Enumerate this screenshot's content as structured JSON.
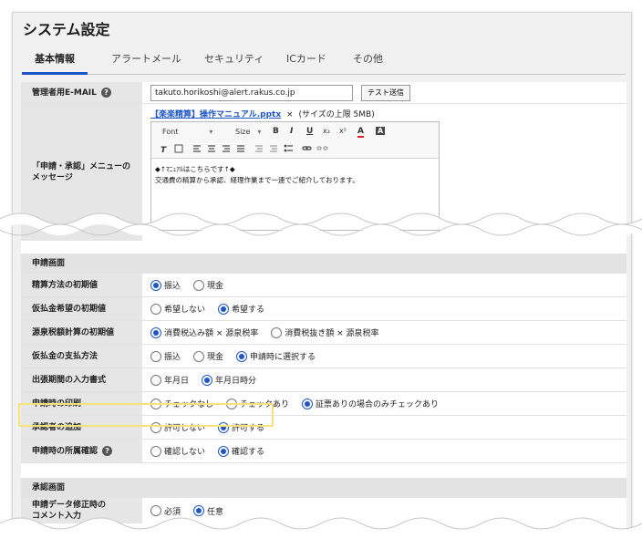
{
  "page_title": "システム設定",
  "tabs": [
    {
      "label": "基本情報",
      "active": true
    },
    {
      "label": "アラートメール",
      "active": false
    },
    {
      "label": "セキュリティ",
      "active": false
    },
    {
      "label": "ICカード",
      "active": false
    },
    {
      "label": "その他",
      "active": false
    }
  ],
  "email": {
    "label": "管理者用E-MAIL",
    "value": "takuto.horikoshi@alert.rakus.co.jp",
    "test_button": "テスト送信"
  },
  "message": {
    "label_line1": "「申請・承認」メニューの",
    "label_line2": "メッセージ",
    "attachment_link": "【楽楽精算】操作マニュアル.pptx",
    "attachment_remove": "×",
    "attachment_note": "(サイズの上限 5MB)",
    "toolbar": {
      "font": "Font",
      "size": "Size",
      "bold": "B",
      "italic": "I",
      "underline": "U",
      "subscript": "x₂",
      "superscript": "x²",
      "text_color": "A",
      "bg_color": "A"
    },
    "editor_line1": "◆↑ﾏﾆｭｱﾙはこちらです↑◆",
    "editor_line2": "交通費の精算から承認、経理作業まで一連でご紹介しております。"
  },
  "section_apply": {
    "title": "申請画面",
    "rows": [
      {
        "label": "精算方法の初期値",
        "options": [
          {
            "label": "振込",
            "checked": true
          },
          {
            "label": "現金",
            "checked": false
          }
        ]
      },
      {
        "label": "仮払金希望の初期値",
        "options": [
          {
            "label": "希望しない",
            "checked": false
          },
          {
            "label": "希望する",
            "checked": true
          }
        ]
      },
      {
        "label": "源泉税額計算の初期値",
        "options": [
          {
            "label": "消費税込み額 × 源泉税率",
            "checked": true
          },
          {
            "label": "消費税抜き額 × 源泉税率",
            "checked": false
          }
        ]
      },
      {
        "label": "仮払金の支払方法",
        "options": [
          {
            "label": "振込",
            "checked": false
          },
          {
            "label": "現金",
            "checked": false
          },
          {
            "label": "申請時に選択する",
            "checked": true
          }
        ]
      },
      {
        "label": "出張期間の入力書式",
        "options": [
          {
            "label": "年月日",
            "checked": false
          },
          {
            "label": "年月日時分",
            "checked": true
          }
        ]
      },
      {
        "label": "申請時の印刷",
        "options": [
          {
            "label": "チェックなし",
            "checked": false
          },
          {
            "label": "チェックあり",
            "checked": false
          },
          {
            "label": "証票ありの場合のみチェックあり",
            "checked": true
          }
        ]
      },
      {
        "label": "承認者の追加",
        "options": [
          {
            "label": "許可しない",
            "checked": false
          },
          {
            "label": "許可する",
            "checked": true
          }
        ]
      },
      {
        "label": "申請時の所属確認",
        "options": [
          {
            "label": "確認しない",
            "checked": false
          },
          {
            "label": "確認する",
            "checked": true
          }
        ]
      }
    ]
  },
  "section_approve": {
    "title": "承認画面",
    "row": {
      "label_line1": "申請データ修正時の",
      "label_line2": "コメント入力",
      "options": [
        {
          "label": "必須",
          "checked": false
        },
        {
          "label": "任意",
          "checked": true
        }
      ]
    }
  },
  "colors": {
    "accent": "#1f56c4",
    "highlight": "#f5e278",
    "label_bg": "#e6e6e6",
    "section_bg": "#e3e3e3"
  }
}
